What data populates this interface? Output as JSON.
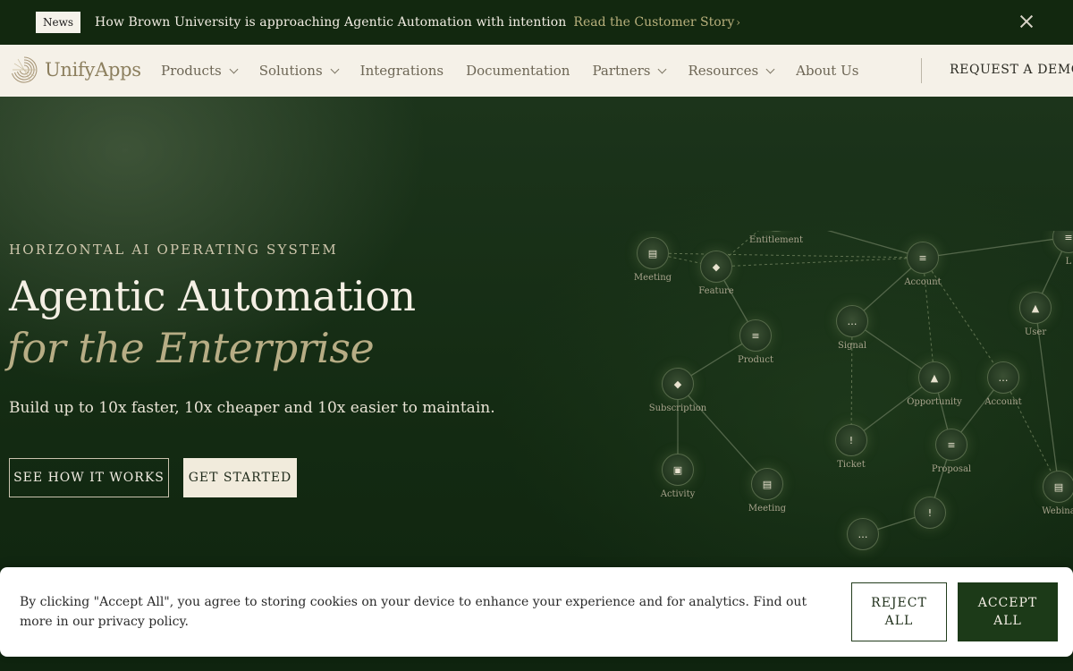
{
  "announcement": {
    "badge": "News",
    "text": "How Brown University is approaching Agentic Automation with intention",
    "link": "Read the Customer Story",
    "link_chevron": "›"
  },
  "nav": {
    "logo_text": "UnifyApps",
    "items": [
      {
        "label": "Products",
        "dropdown": true
      },
      {
        "label": "Solutions",
        "dropdown": true
      },
      {
        "label": "Integrations",
        "dropdown": false
      },
      {
        "label": "Documentation",
        "dropdown": false
      },
      {
        "label": "Partners",
        "dropdown": true
      },
      {
        "label": "Resources",
        "dropdown": true
      },
      {
        "label": "About Us",
        "dropdown": false
      }
    ],
    "cta": "REQUEST A DEMO"
  },
  "hero": {
    "eyebrow": "HORIZONTAL AI OPERATING SYSTEM",
    "title": "Agentic Automation",
    "title_italic": "for the Enterprise",
    "subtitle": "Build up to 10x faster, 10x cheaper and 10x easier to maintain.",
    "btn_primary": "SEE HOW IT WORKS",
    "btn_secondary": "GET STARTED"
  },
  "graph": {
    "nodes": [
      {
        "label": "Entitlement",
        "icon": "chat-icon"
      },
      {
        "label": "Meeting",
        "icon": "calendar-icon"
      },
      {
        "label": "Feature",
        "icon": "tag-icon"
      },
      {
        "label": "Account",
        "icon": "document-icon"
      },
      {
        "label": "L",
        "icon": "document-icon"
      },
      {
        "label": "User",
        "icon": "user-icon"
      },
      {
        "label": "Signal",
        "icon": "chat-icon"
      },
      {
        "label": "Product",
        "icon": "document-icon"
      },
      {
        "label": "Opportunity",
        "icon": "user-icon"
      },
      {
        "label": "Account",
        "icon": "chat-icon"
      },
      {
        "label": "Subscription",
        "icon": "tag-icon"
      },
      {
        "label": "Ticket",
        "icon": "alert-icon"
      },
      {
        "label": "Proposal",
        "icon": "document-icon"
      },
      {
        "label": "Activity",
        "icon": "briefcase-icon"
      },
      {
        "label": "Meeting",
        "icon": "calendar-icon"
      },
      {
        "label": "Webina",
        "icon": "calendar-icon"
      },
      {
        "label": "",
        "icon": "alert-icon"
      },
      {
        "label": "",
        "icon": "chat-icon"
      }
    ]
  },
  "cookie": {
    "text": "By clicking \"Accept All\", you agree to storing cookies on your device to enhance your experience and for analytics. Find out more in our privacy policy.",
    "reject_line1": "REJECT",
    "reject_line2": "ALL",
    "accept_line1": "ACCEPT",
    "accept_line2": "ALL"
  },
  "colors": {
    "background": "#0f240f",
    "announcement_bg": "#12280f",
    "navbar_bg": "#f5f1e8",
    "accent_gold": "#b7ad85",
    "button_light": "#f1ebdc",
    "accept_green": "#1c3a18"
  }
}
